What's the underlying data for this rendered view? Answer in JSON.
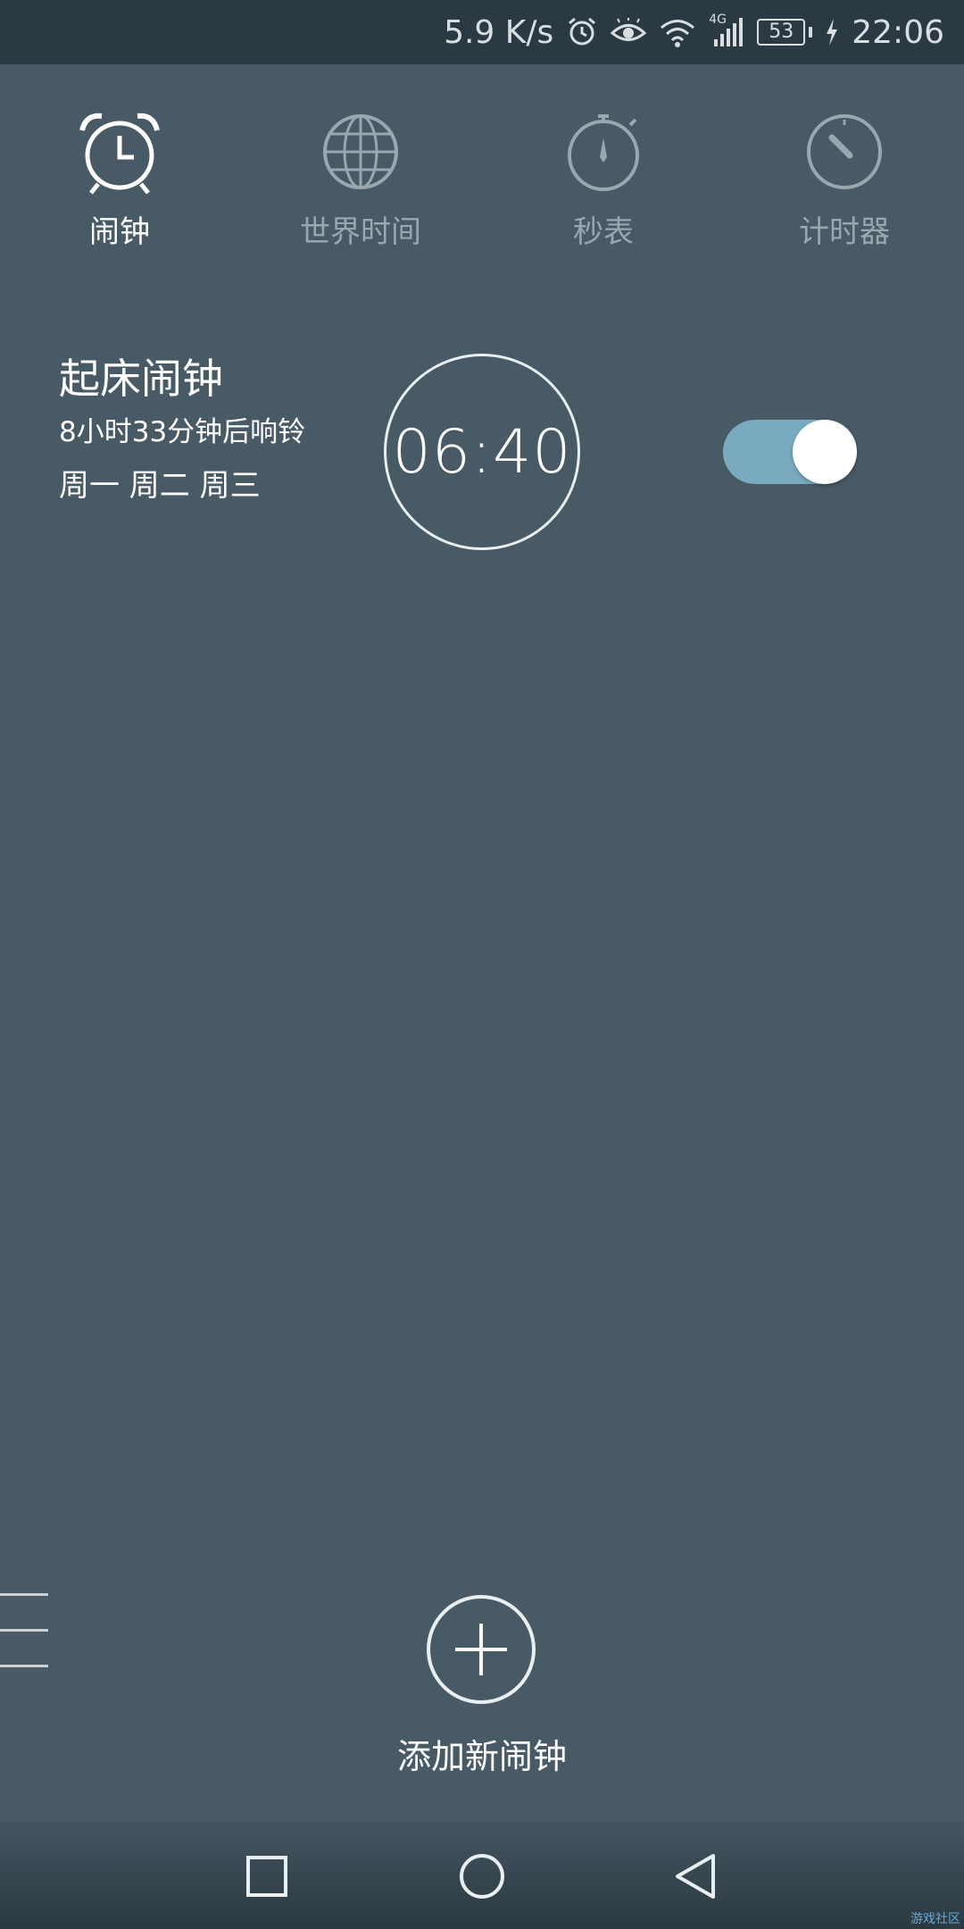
{
  "status_bar": {
    "speed": "5.9 K/s",
    "network_type": "4G",
    "battery": "53",
    "time": "22:06",
    "icons": [
      "alarm-icon",
      "eye-icon",
      "wifi-icon",
      "signal-icon",
      "battery-icon",
      "charging-icon"
    ]
  },
  "tabs": [
    {
      "label": "闹钟",
      "icon": "alarm-clock-icon",
      "active": true
    },
    {
      "label": "世界时间",
      "icon": "globe-icon",
      "active": false
    },
    {
      "label": "秒表",
      "icon": "stopwatch-icon",
      "active": false
    },
    {
      "label": "计时器",
      "icon": "timer-icon",
      "active": false
    }
  ],
  "alarm": {
    "name": "起床闹钟",
    "countdown": "8小时33分钟后响铃",
    "days": "周一 周二 周三",
    "time": "06:40",
    "enabled": true
  },
  "add_alarm": {
    "label": "添加新闹钟"
  },
  "colors": {
    "background": "#475a66",
    "status_bar": "#2b3a42",
    "toggle_on": "#7aaac0",
    "inactive_text": "#9aa7ae"
  },
  "watermark": "游戏社区"
}
